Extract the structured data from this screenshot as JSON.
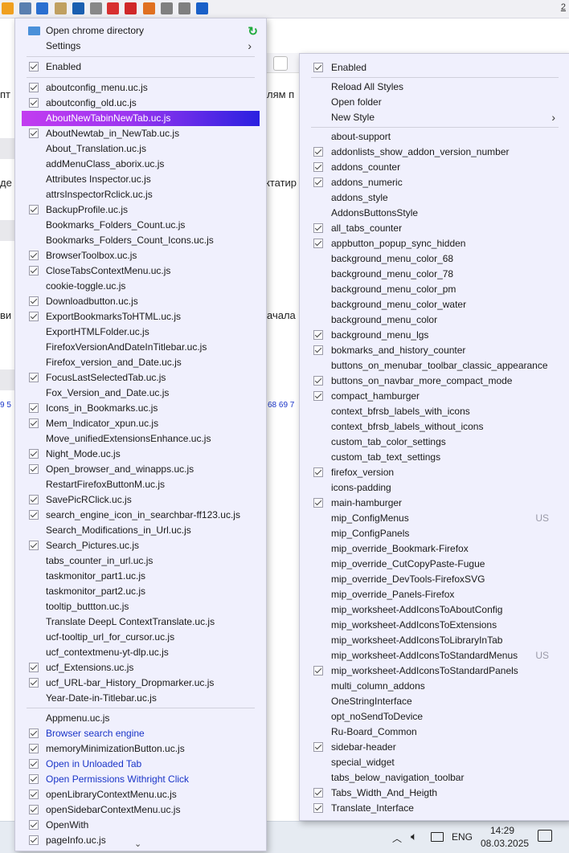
{
  "toolbar": {
    "icons": [
      {
        "name": "download-arrow-icon",
        "color": "#f0a020"
      },
      {
        "name": "puzzle-icon",
        "color": "#5a7fb0"
      },
      {
        "name": "save-icon",
        "color": "#2a6fd0"
      },
      {
        "name": "notes-icon",
        "color": "#c0a060"
      },
      {
        "name": "search-plugin-icon",
        "color": "#1a5fb0"
      },
      {
        "name": "clock-icon",
        "color": "#888888"
      },
      {
        "name": "pick-icon",
        "color": "#d83030"
      },
      {
        "name": "close-tab-icon",
        "color": "#d02828"
      },
      {
        "name": "bookmark-icon",
        "color": "#e07020"
      },
      {
        "name": "page-icon",
        "color": "#808080"
      },
      {
        "name": "gear-icon",
        "color": "#808080"
      },
      {
        "name": "download-icon",
        "color": "#1a60c8"
      }
    ],
    "count": "2"
  },
  "background_fragments": {
    "left_word_1": "пт",
    "left_word_2": "де",
    "left_word_3": "ви",
    "right_word_1": "лям п",
    "right_word_2": "ктатир",
    "right_word_3": "ачала",
    "left_nums": "9 5",
    "right_nums": "68 69 7"
  },
  "taskbar": {
    "lang": "ENG",
    "time": "14:29",
    "date": "08.03.2025"
  },
  "left_menu": {
    "header": [
      {
        "label": "Open chrome directory"
      },
      {
        "label": "Settings"
      }
    ],
    "enabled_label": "Enabled",
    "items": [
      {
        "label": "aboutconfig_menu.uc.js",
        "checked": true
      },
      {
        "label": "aboutconfig_old.uc.js",
        "checked": true
      },
      {
        "label": "AboutNewTabinNewTab.uc.js",
        "checked": false,
        "highlight": true
      },
      {
        "label": "AboutNewtab_in_NewTab.uc.js",
        "checked": true
      },
      {
        "label": "About_Translation.uc.js",
        "checked": false
      },
      {
        "label": "addMenuClass_aborix.uc.js",
        "checked": false
      },
      {
        "label": "Attributes Inspector.uc.js",
        "checked": false
      },
      {
        "label": "attrsInspectorRclick.uc.js",
        "checked": false
      },
      {
        "label": "BackupProfile.uc.js",
        "checked": true
      },
      {
        "label": "Bookmarks_Folders_Count.uc.js",
        "checked": false
      },
      {
        "label": "Bookmarks_Folders_Count_Icons.uc.js",
        "checked": false
      },
      {
        "label": "BrowserToolbox.uc.js",
        "checked": true
      },
      {
        "label": "CloseTabsContextMenu.uc.js",
        "checked": true
      },
      {
        "label": "cookie-toggle.uc.js",
        "checked": false
      },
      {
        "label": "Downloadbutton.uc.js",
        "checked": true
      },
      {
        "label": "ExportBookmarksToHTML.uc.js",
        "checked": true
      },
      {
        "label": "ExportHTMLFolder.uc.js",
        "checked": false
      },
      {
        "label": "FirefoxVersionAndDateInTitlebar.uc.js",
        "checked": false
      },
      {
        "label": "Firefox_version_and_Date.uc.js",
        "checked": false
      },
      {
        "label": "FocusLastSelectedTab.uc.js",
        "checked": true
      },
      {
        "label": "Fox_Version_and_Date.uc.js",
        "checked": false
      },
      {
        "label": "Icons_in_Bookmarks.uc.js",
        "checked": true
      },
      {
        "label": "Mem_Indicator_xpun.uc.js",
        "checked": true
      },
      {
        "label": "Move_unifiedExtensionsEnhance.uc.js",
        "checked": false
      },
      {
        "label": "Night_Mode.uc.js",
        "checked": true
      },
      {
        "label": "Open_browser_and_winapps.uc.js",
        "checked": true
      },
      {
        "label": "RestartFirefoxButtonM.uc.js",
        "checked": false
      },
      {
        "label": "SavePicRClick.uc.js",
        "checked": true
      },
      {
        "label": "search_engine_icon_in_searchbar-ff123.uc.js",
        "checked": true
      },
      {
        "label": "Search_Modifications_in_Url.uc.js",
        "checked": false
      },
      {
        "label": "Search_Pictures.uc.js",
        "checked": true
      },
      {
        "label": "tabs_counter_in_url.uc.js",
        "checked": false
      },
      {
        "label": "taskmonitor_part1.uc.js",
        "checked": false
      },
      {
        "label": "taskmonitor_part2.uc.js",
        "checked": false
      },
      {
        "label": "tooltip_buttton.uc.js",
        "checked": false
      },
      {
        "label": "Translate DeepL ContextTranslate.uc.js",
        "checked": false
      },
      {
        "label": "ucf-tooltip_url_for_cursor.uc.js",
        "checked": false
      },
      {
        "label": "ucf_contextmenu-yt-dlp.uc.js",
        "checked": false
      },
      {
        "label": "ucf_Extensions.uc.js",
        "checked": true
      },
      {
        "label": "ucf_URL-bar_History_Dropmarker.uc.js",
        "checked": true
      },
      {
        "label": "Year-Date-in-Titlebar.uc.js",
        "checked": false
      }
    ],
    "footer": [
      {
        "label": "Appmenu.uc.js",
        "checked": false,
        "blue": false
      },
      {
        "label": "Browser search engine",
        "checked": true,
        "blue": true
      },
      {
        "label": "memoryMinimizationButton.uc.js",
        "checked": true,
        "blue": false
      },
      {
        "label": "Open in Unloaded Tab",
        "checked": true,
        "blue": true
      },
      {
        "label": "Open Permissions Withright Click",
        "checked": true,
        "blue": true
      },
      {
        "label": "openLibraryContextMenu.uc.js",
        "checked": true,
        "blue": false
      },
      {
        "label": "openSidebarContextMenu.uc.js",
        "checked": true,
        "blue": false
      },
      {
        "label": "OpenWith",
        "checked": true,
        "blue": false
      },
      {
        "label": "pageInfo.uc.js",
        "checked": true,
        "blue": false
      }
    ],
    "scroll_glyph": "⌄"
  },
  "right_menu": {
    "enabled_label": "Enabled",
    "actions": [
      {
        "label": "Reload All Styles"
      },
      {
        "label": "Open folder"
      },
      {
        "label": "New Style"
      }
    ],
    "items": [
      {
        "label": "about-support",
        "checked": false
      },
      {
        "label": "addonlists_show_addon_version_number",
        "checked": true
      },
      {
        "label": "addons_counter",
        "checked": true
      },
      {
        "label": "addons_numeric",
        "checked": true
      },
      {
        "label": "addons_style",
        "checked": false
      },
      {
        "label": "AddonsButtonsStyle",
        "checked": false
      },
      {
        "label": "all_tabs_counter",
        "checked": true
      },
      {
        "label": "appbutton_popup_sync_hidden",
        "checked": true
      },
      {
        "label": "background_menu_color_68",
        "checked": false
      },
      {
        "label": "background_menu_color_78",
        "checked": false
      },
      {
        "label": "background_menu_color_pm",
        "checked": false
      },
      {
        "label": "background_menu_color_water",
        "checked": false
      },
      {
        "label": "background_menu_color",
        "checked": false
      },
      {
        "label": "background_menu_lgs",
        "checked": true
      },
      {
        "label": "bokmarks_and_history_counter",
        "checked": true
      },
      {
        "label": "buttons_on_menubar_toolbar_classic_appearance",
        "checked": false
      },
      {
        "label": "buttons_on_navbar_more_compact_mode",
        "checked": true
      },
      {
        "label": "compact_hamburger",
        "checked": true
      },
      {
        "label": "context_bfrsb_labels_with_icons",
        "checked": false
      },
      {
        "label": "context_bfrsb_labels_without_icons",
        "checked": false
      },
      {
        "label": "custom_tab_color_settings",
        "checked": false
      },
      {
        "label": "custom_tab_text_settings",
        "checked": false
      },
      {
        "label": "firefox_version",
        "checked": true
      },
      {
        "label": "icons-padding",
        "checked": false
      },
      {
        "label": "main-hamburger",
        "checked": true
      },
      {
        "label": "mip_ConfigMenus",
        "checked": false,
        "note": "US"
      },
      {
        "label": "mip_ConfigPanels",
        "checked": false
      },
      {
        "label": "mip_override_Bookmark-Firefox",
        "checked": false
      },
      {
        "label": "mip_override_CutCopyPaste-Fugue",
        "checked": false
      },
      {
        "label": "mip_override_DevTools-FirefoxSVG",
        "checked": false
      },
      {
        "label": "mip_override_Panels-Firefox",
        "checked": false
      },
      {
        "label": "mip_worksheet-AddIconsToAboutConfig",
        "checked": false
      },
      {
        "label": "mip_worksheet-AddIconsToExtensions",
        "checked": false
      },
      {
        "label": "mip_worksheet-AddIconsToLibraryInTab",
        "checked": false
      },
      {
        "label": "mip_worksheet-AddIconsToStandardMenus",
        "checked": false,
        "note": "US"
      },
      {
        "label": "mip_worksheet-AddIconsToStandardPanels",
        "checked": true
      },
      {
        "label": "multi_column_addons",
        "checked": false
      },
      {
        "label": "OneStringInterface",
        "checked": false
      },
      {
        "label": "opt_noSendToDevice",
        "checked": false
      },
      {
        "label": "Ru-Board_Common",
        "checked": false
      },
      {
        "label": "sidebar-header",
        "checked": true
      },
      {
        "label": "special_widget",
        "checked": false
      },
      {
        "label": "tabs_below_navigation_toolbar",
        "checked": false
      },
      {
        "label": "Tabs_Width_And_Heigth",
        "checked": true
      },
      {
        "label": "Translate_Interface",
        "checked": true
      }
    ]
  }
}
